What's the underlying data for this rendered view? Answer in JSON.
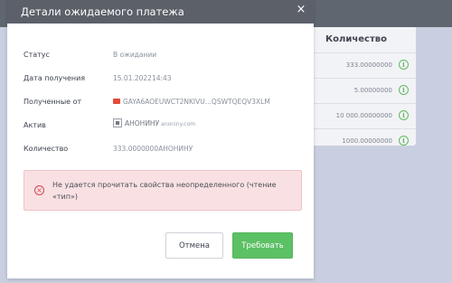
{
  "background": {
    "panel": {
      "column_header": "Количество",
      "rows": [
        {
          "quantity": "333.00000000"
        },
        {
          "quantity": "5.00000000"
        },
        {
          "quantity": "10 000.00000000"
        },
        {
          "quantity": "1000.00000000"
        }
      ],
      "info_icon_glyph": "i"
    }
  },
  "modal": {
    "title": "Детали ожидаемого платежа",
    "close_glyph": "×",
    "fields": {
      "status_label": "Статус",
      "status_value": "В ожидании",
      "date_label": "Дата получения",
      "date_value": "15.01.202214:43",
      "from_label": "Полученные от",
      "from_value": "GAYA6AOEUWCT2NKIVU...QSWTQEQV3XLM",
      "asset_label": "Актив",
      "asset_name": "АНОНИНУ",
      "asset_domain": "anoniny.com",
      "amount_label": "Количество",
      "amount_value": "333.0000000АНОНИНУ"
    },
    "error": {
      "icon_glyph": "×",
      "message": "Не удается прочитать свойства неопределенного (чтение «тип»)"
    },
    "buttons": {
      "cancel": "Отмена",
      "submit": "Требовать"
    }
  },
  "colors": {
    "header": "#5b6069",
    "submit": "#5cc064",
    "error_bg": "#f9e1e3",
    "error_icon": "#d2464f",
    "info_icon": "#63b863"
  },
  "icons": {
    "from_icon": "mail-icon",
    "asset_icon": "asset-logo-icon"
  }
}
